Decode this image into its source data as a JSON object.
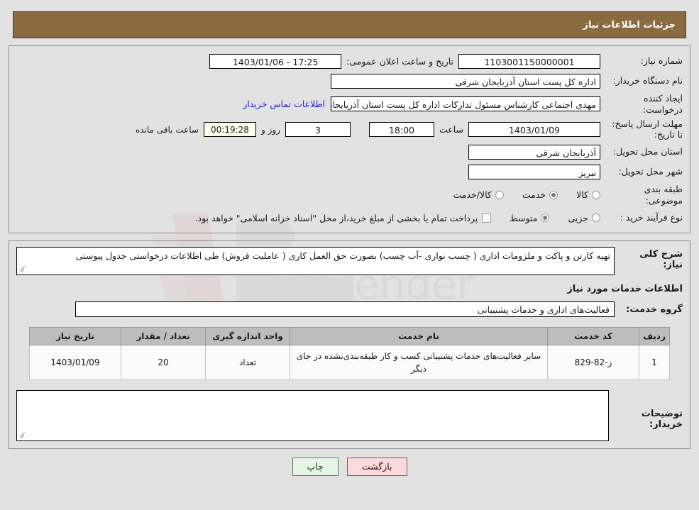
{
  "header": {
    "title": "جزئیات اطلاعات نیاز"
  },
  "form": {
    "need_no_label": "شماره نیاز:",
    "need_no_value": "1103001150000001",
    "announce_label": "تاریخ و ساعت اعلان عمومی:",
    "announce_value": "17:25 - 1403/01/06",
    "buyer_org_label": "نام دستگاه خریدار:",
    "buyer_org_value": "اداره کل پست استان آذربایجان شرقی",
    "creator_label": "ایجاد کننده درخواست:",
    "creator_value": "مهدی اجتماعی کارشناس مسئول تدارکات اداره کل پست استان آذربایجان شرقی",
    "contact_link": "اطلاعات تماس خریدار",
    "deadline_label": "مهلت ارسال پاسخ: تا تاریخ:",
    "deadline_date": "1403/01/09",
    "hour_label": "ساعت",
    "hour_value": "18:00",
    "days_value": "3",
    "days_label": "روز و",
    "timer_value": "00:19:28",
    "remaining_label": "ساعت باقی مانده",
    "province_label": "استان محل تحویل:",
    "province_value": "آذربایجان شرقی",
    "city_label": "شهر محل تحویل:",
    "city_value": "تبریز",
    "category_label": "طبقه بندی موضوعی:",
    "category_options": [
      {
        "label": "کالا",
        "checked": false
      },
      {
        "label": "خدمت",
        "checked": true
      },
      {
        "label": "کالا/خدمت",
        "checked": false
      }
    ],
    "process_label": "نوع فرآیند خرید :",
    "process_options": [
      {
        "label": "جزیی",
        "checked": false
      },
      {
        "label": "متوسط",
        "checked": true
      }
    ],
    "treasury_checked": false,
    "treasury_note": "پرداخت تمام یا بخشی از مبلغ خرید،از محل \"اسناد خزانه اسلامی\" خواهد بود."
  },
  "details": {
    "desc_label": "شرح کلی نیاز:",
    "desc_value": "تهیه کارتن و پاکت و ملزومات اداری ( چسب نواری -آب چسب) بصورت حق العمل کاری ( عاملیت فروش)  طی اطلاعات درخواستی جدول پیوستی",
    "section_title": "اطلاعات خدمات مورد نیاز",
    "group_label": "گروه خدمت:",
    "group_value": "فعالیت‌های اداری و خدمات پشتیبانی"
  },
  "table": {
    "columns": [
      "ردیف",
      "کد خدمت",
      "نام خدمت",
      "واحد اندازه گیری",
      "تعداد / مقدار",
      "تاریخ نیاز"
    ],
    "rows": [
      {
        "radif": "1",
        "code": "ز-82-829",
        "name": "سایر فعالیت‌های خدمات پشتیبانی کسب و کار طبقه‌بندی‌نشده در جای دیگر",
        "unit": "تعداد",
        "qty": "20",
        "date": "1403/01/09"
      }
    ]
  },
  "comments": {
    "label": "توضیحات خریدار:",
    "value": ""
  },
  "footer": {
    "print_label": "چاپ",
    "back_label": "بازگشت"
  },
  "watermark": {
    "text": "AriaTender.net"
  }
}
